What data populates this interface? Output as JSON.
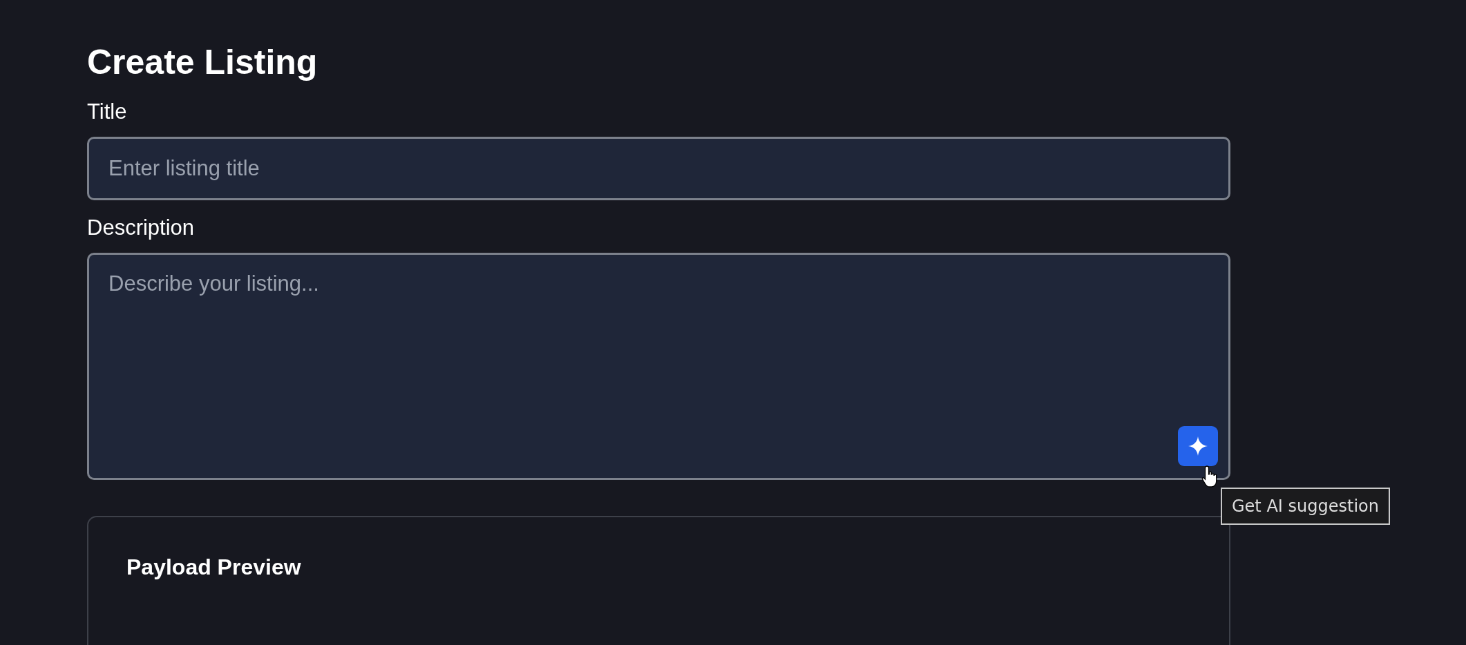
{
  "heading": "Create Listing",
  "fields": [
    {
      "kind": "input",
      "label": "Title",
      "placeholder": "Enter listing title"
    },
    {
      "kind": "textarea",
      "label": "Description",
      "placeholder": "Describe your listing...",
      "ai_button": {
        "tooltip": "Get AI suggestion"
      }
    }
  ],
  "preview": {
    "title": "Payload Preview"
  }
}
